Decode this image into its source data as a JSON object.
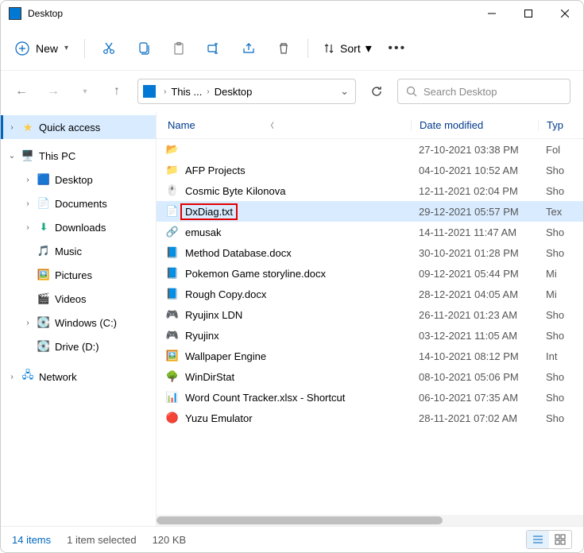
{
  "window": {
    "title": "Desktop"
  },
  "toolbar": {
    "new_label": "New",
    "sort_label": "Sort"
  },
  "breadcrumb": {
    "seg1": "This ...",
    "seg2": "Desktop"
  },
  "search": {
    "placeholder": "Search Desktop"
  },
  "sidebar": {
    "quick": "Quick access",
    "this_pc": "This PC",
    "desktop": "Desktop",
    "documents": "Documents",
    "downloads": "Downloads",
    "music": "Music",
    "pictures": "Pictures",
    "videos": "Videos",
    "win_c": "Windows (C:)",
    "drive_d": "Drive (D:)",
    "network": "Network"
  },
  "columns": {
    "name": "Name",
    "modified": "Date modified",
    "type": "Typ"
  },
  "files": [
    {
      "name": "",
      "mod": "27-10-2021 03:38 PM",
      "typ": "Fol",
      "icon": "📂"
    },
    {
      "name": "AFP Projects",
      "mod": "04-10-2021 10:52 AM",
      "typ": "Sho",
      "icon": "📁"
    },
    {
      "name": "Cosmic Byte Kilonova",
      "mod": "12-11-2021 02:04 PM",
      "typ": "Sho",
      "icon": "🖱️"
    },
    {
      "name": "DxDiag.txt",
      "mod": "29-12-2021 05:57 PM",
      "typ": "Tex",
      "icon": "📄",
      "selected": true,
      "highlight": true
    },
    {
      "name": "emusak",
      "mod": "14-11-2021 11:47 AM",
      "typ": "Sho",
      "icon": "🔗"
    },
    {
      "name": "Method Database.docx",
      "mod": "30-10-2021 01:28 PM",
      "typ": "Sho",
      "icon": "📘"
    },
    {
      "name": "Pokemon Game storyline.docx",
      "mod": "09-12-2021 05:44 PM",
      "typ": "Mi",
      "icon": "📘"
    },
    {
      "name": "Rough Copy.docx",
      "mod": "28-12-2021 04:05 AM",
      "typ": "Mi",
      "icon": "📘"
    },
    {
      "name": "Ryujinx LDN",
      "mod": "26-11-2021 01:23 AM",
      "typ": "Sho",
      "icon": "🎮"
    },
    {
      "name": "Ryujinx",
      "mod": "03-12-2021 11:05 AM",
      "typ": "Sho",
      "icon": "🎮"
    },
    {
      "name": "Wallpaper Engine",
      "mod": "14-10-2021 08:12 PM",
      "typ": "Int",
      "icon": "🖼️"
    },
    {
      "name": "WinDirStat",
      "mod": "08-10-2021 05:06 PM",
      "typ": "Sho",
      "icon": "🌳"
    },
    {
      "name": "Word Count Tracker.xlsx - Shortcut",
      "mod": "06-10-2021 07:35 AM",
      "typ": "Sho",
      "icon": "📊"
    },
    {
      "name": "Yuzu Emulator",
      "mod": "28-11-2021 07:02 AM",
      "typ": "Sho",
      "icon": "🔴"
    }
  ],
  "status": {
    "count_label": "14 items",
    "selected_label": "1 item selected",
    "size_label": "120 KB"
  }
}
